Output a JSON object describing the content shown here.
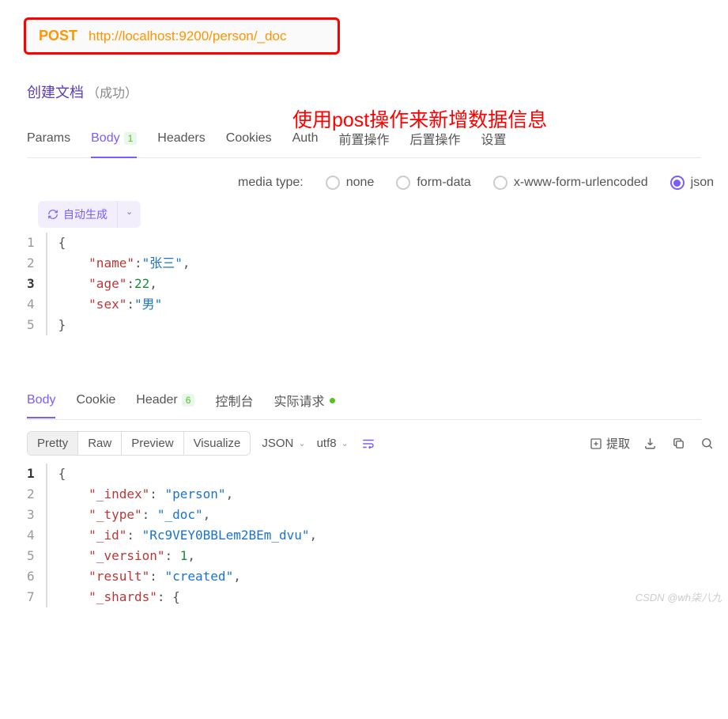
{
  "request": {
    "method": "POST",
    "url": "http://localhost:9200/person/_doc"
  },
  "doc": {
    "title": "创建文档",
    "status": "（成功）"
  },
  "annotation": "使用post操作来新增数据信息",
  "tabs": {
    "params": "Params",
    "body": "Body",
    "body_badge": "1",
    "headers": "Headers",
    "cookies": "Cookies",
    "auth": "Auth",
    "pre": "前置操作",
    "post": "后置操作",
    "settings": "设置"
  },
  "media": {
    "label": "media type:",
    "none": "none",
    "formdata": "form-data",
    "xform": "x-www-form-urlencoded",
    "json": "json"
  },
  "gen_btn": "自动生成",
  "request_body": {
    "lines": [
      "1",
      "2",
      "3",
      "4",
      "5"
    ],
    "l1": "{",
    "k1": "\"name\"",
    "v1": "\"张三\"",
    "k2": "\"age\"",
    "v2n": "22",
    "k3": "\"sex\"",
    "v3": "\"男\"",
    "l5": "}"
  },
  "resp_tabs": {
    "body": "Body",
    "cookie": "Cookie",
    "header": "Header",
    "header_badge": "6",
    "console": "控制台",
    "actual": "实际请求"
  },
  "resp_toolbar": {
    "pretty": "Pretty",
    "raw": "Raw",
    "preview": "Preview",
    "visualize": "Visualize",
    "format": "JSON",
    "charset": "utf8",
    "extract": "提取"
  },
  "response_body": {
    "lines": [
      "1",
      "2",
      "3",
      "4",
      "5",
      "6",
      "7"
    ],
    "l1": "{",
    "k1": "\"_index\"",
    "v1": "\"person\"",
    "k2": "\"_type\"",
    "v2": "\"_doc\"",
    "k3": "\"_id\"",
    "v3": "\"Rc9VEY0BBLem2BEm_dvu\"",
    "k4": "\"_version\"",
    "v4n": "1",
    "k5": "\"result\"",
    "v5": "\"created\"",
    "k6": "\"_shards\"",
    "l7": "{"
  },
  "watermark": "CSDN @wh柒八九"
}
